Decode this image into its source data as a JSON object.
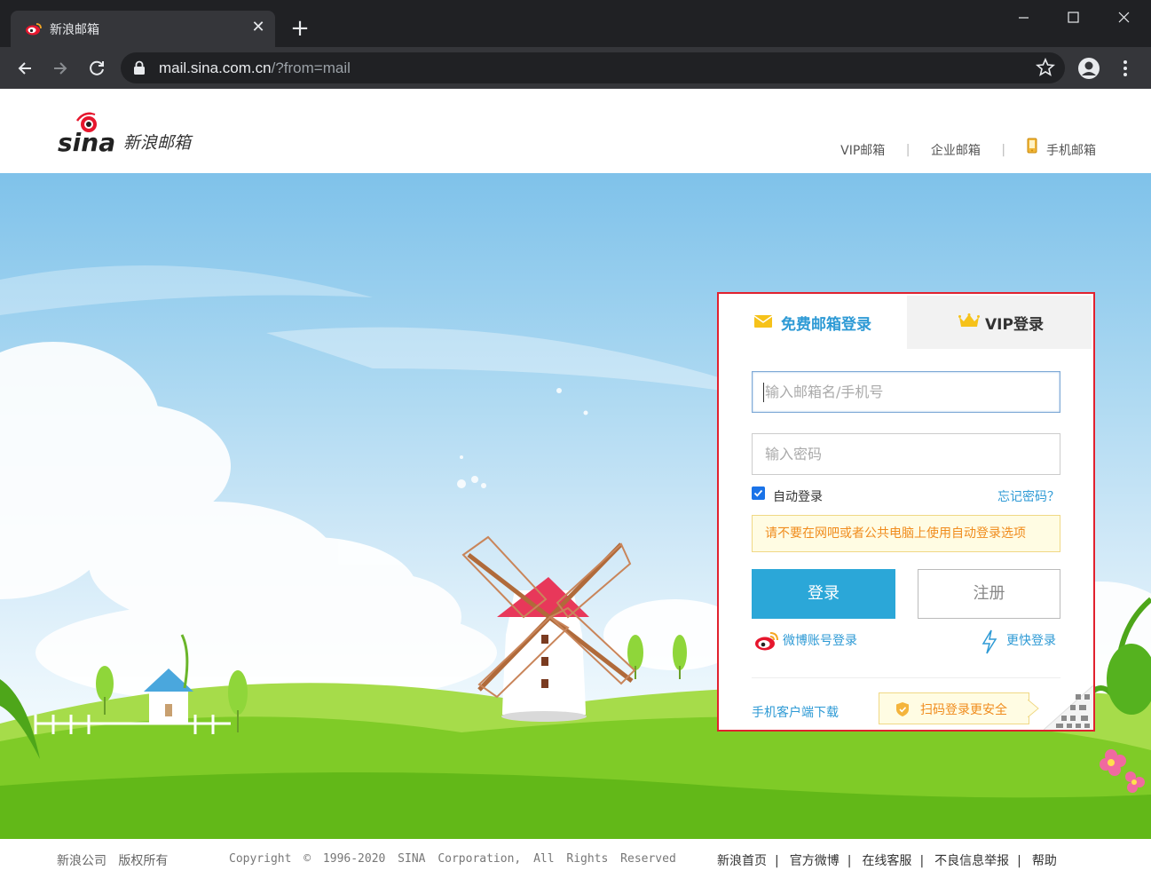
{
  "browser": {
    "tab_title": "新浪邮箱",
    "url_host": "mail.sina.com.cn",
    "url_path": "/?from=mail"
  },
  "header": {
    "logo_text": "新浪邮箱",
    "links": [
      {
        "label": "VIP邮箱"
      },
      {
        "label": "企业邮箱"
      },
      {
        "label": "手机邮箱"
      }
    ]
  },
  "login": {
    "tabs": [
      {
        "label": "免费邮箱登录",
        "active": true
      },
      {
        "label": "VIP登录",
        "active": false
      }
    ],
    "email_placeholder": "输入邮箱名/手机号",
    "email_value": "",
    "password_placeholder": "输入密码",
    "password_value": "",
    "auto_login_label": "自动登录",
    "auto_login_checked": true,
    "forgot_password": "忘记密码？",
    "warning": "请不要在网吧或者公共电脑上使用自动登录选项",
    "login_button": "登录",
    "register_button": "注册",
    "weibo_login": "微博账号登录",
    "fast_login": "更快登录",
    "mobile_download": "手机客户端下载",
    "qr_tip": "扫码登录更安全"
  },
  "footer": {
    "company": "新浪公司   版权所有",
    "copyright": "Copyright © 1996-2020 SINA Corporation, All Rights Reserved",
    "links": [
      "新浪首页",
      "官方微博",
      "在线客服",
      "不良信息举报",
      "帮助"
    ]
  },
  "colors": {
    "accent_blue": "#2ba7d8",
    "link_blue": "#2e9ad5",
    "highlight_border": "#e1212e",
    "warning_text": "#f08c1d"
  }
}
